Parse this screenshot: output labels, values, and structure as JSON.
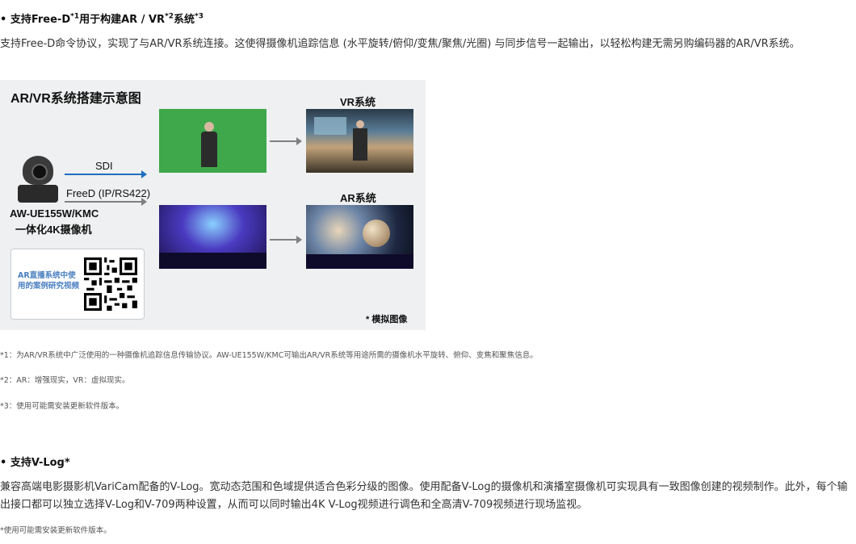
{
  "section1": {
    "heading_main": "• 支持Free-D",
    "heading_sup1": "*1",
    "heading_mid": "用于构建AR / VR",
    "heading_sup2": "*2",
    "heading_end": "系统",
    "heading_sup3": "*3",
    "paragraph": "支持Free-D命令协议，实现了与AR/VR系统连接。这使得摄像机追踪信息 (水平旋转/俯仰/变焦/聚焦/光圈) 与同步信号一起输出，以轻松构建无需另购编码器的AR/VR系统。"
  },
  "diagram": {
    "title": "AR/VR系统搭建示意图",
    "vr_label": "VR系统",
    "ar_label": "AR系统",
    "sdi_label": "SDI",
    "freed_label": "FreeD (IP/RS422)",
    "camera_model": "AW-UE155W/KMC",
    "camera_desc": "一体化4K摄像机",
    "qr_text": "AR直播系统中使用的案例研究视频",
    "note": "* 模拟图像",
    "colors": {
      "sdi_arrow": "#1f6fc0",
      "grey_arrow": "#808080"
    }
  },
  "notes": [
    "*1：为AR/VR系统中广泛使用的一种摄像机追踪信息传输协议。AW-UE155W/KMC可输出AR/VR系统等用途所需的摄像机水平旋转、俯仰、变焦和聚焦信息。",
    "*2：AR：增强现实，VR：虚拟现实。",
    "*3：使用可能需安装更新软件版本。"
  ],
  "section2": {
    "heading": "• 支持V-Log*",
    "paragraph": "兼容高端电影摄影机VariCam配备的V-Log。宽动态范围和色域提供适合色彩分级的图像。使用配备V-Log的摄像机和演播室摄像机可实现具有一致图像创建的视频制作。此外，每个输出接口都可以独立选择V-Log和V-709两种设置，从而可以同时输出4K V-Log视频进行调色和全高清V-709视频进行现场监视。",
    "note": "*使用可能需安装更新软件版本。"
  }
}
